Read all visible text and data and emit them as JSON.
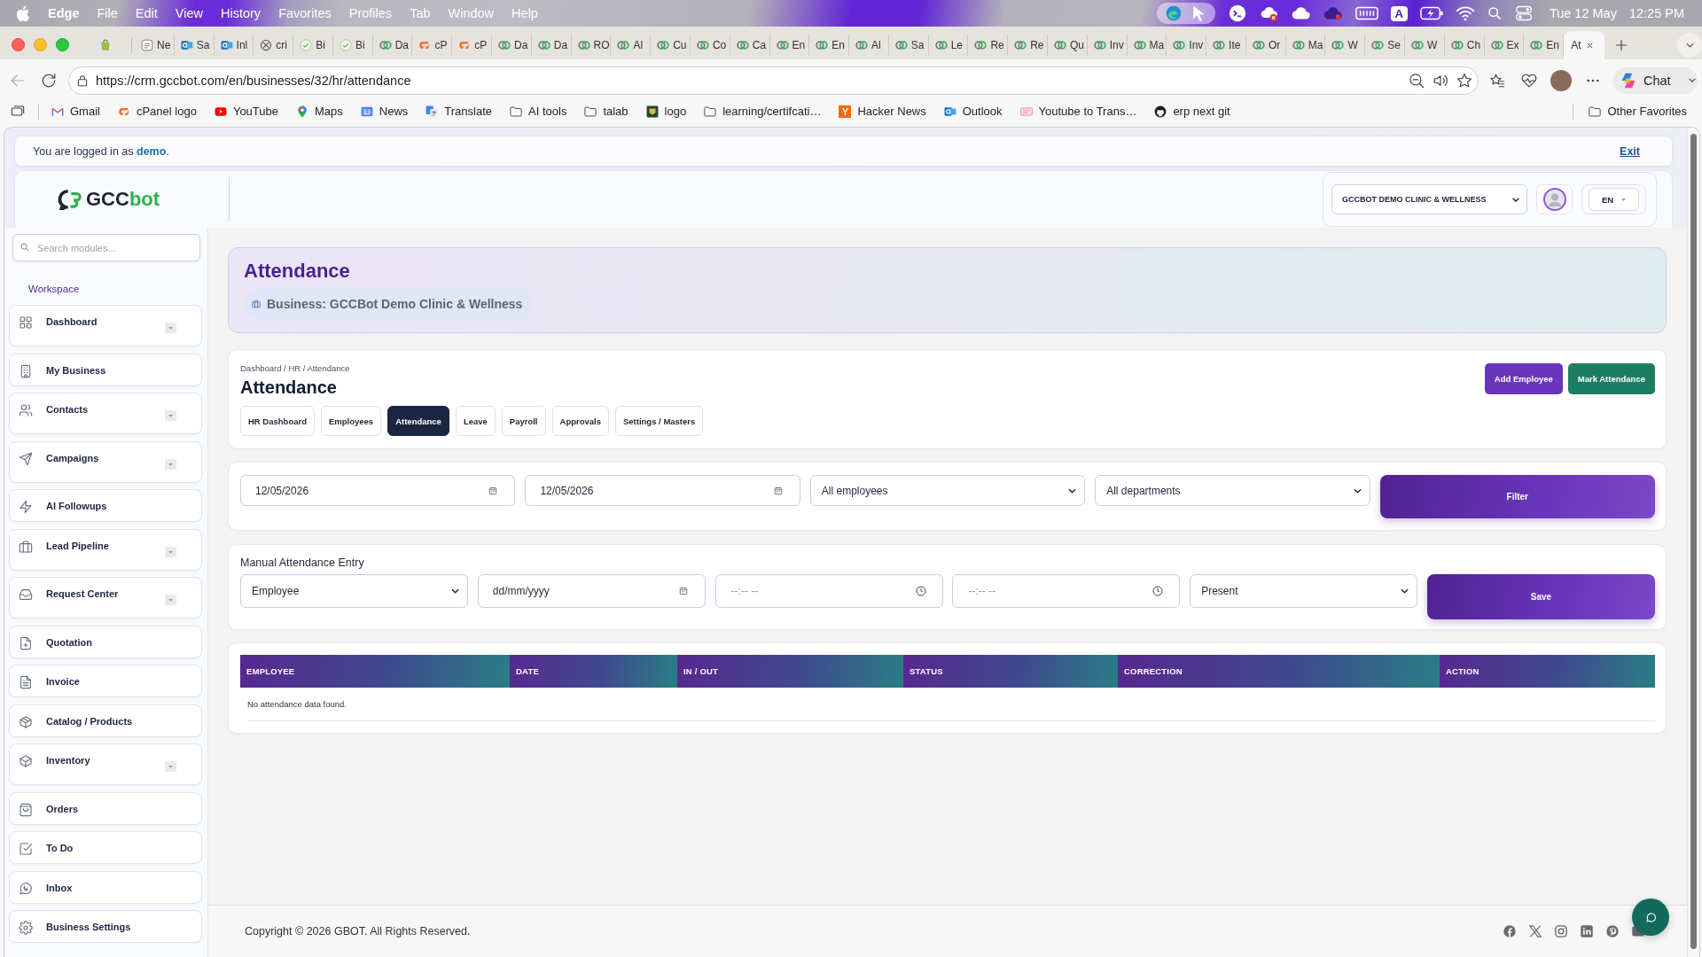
{
  "menu_bar": {
    "app": "Edge",
    "menus": [
      "File",
      "Edit",
      "View",
      "History",
      "Favorites",
      "Profiles",
      "Tab",
      "Window",
      "Help"
    ],
    "input_source": "A",
    "date": "Tue 12 May",
    "time": "12:25 PM"
  },
  "tabs": [
    {
      "title": "Ne",
      "kind": "calendar",
      "selected": false
    },
    {
      "title": "Sa",
      "kind": "mail",
      "selected": false
    },
    {
      "title": "Inl",
      "kind": "mail",
      "selected": false
    },
    {
      "title": "cri",
      "kind": "knot",
      "selected": false
    },
    {
      "title": "Bi",
      "kind": "check",
      "selected": false
    },
    {
      "title": "Bi",
      "kind": "check",
      "selected": false
    },
    {
      "title": "Da",
      "kind": "rings",
      "selected": false
    },
    {
      "title": "cP",
      "kind": "swirl",
      "selected": false
    },
    {
      "title": "cP",
      "kind": "swirl",
      "selected": false
    },
    {
      "title": "Da",
      "kind": "rings",
      "selected": false
    },
    {
      "title": "Da",
      "kind": "rings",
      "selected": false
    },
    {
      "title": "RO",
      "kind": "rings",
      "selected": false
    },
    {
      "title": "Al",
      "kind": "rings",
      "selected": false
    },
    {
      "title": "Cu",
      "kind": "rings",
      "selected": false
    },
    {
      "title": "Co",
      "kind": "rings",
      "selected": false
    },
    {
      "title": "Ca",
      "kind": "rings",
      "selected": false
    },
    {
      "title": "En",
      "kind": "rings",
      "selected": false
    },
    {
      "title": "En",
      "kind": "rings",
      "selected": false
    },
    {
      "title": "Al",
      "kind": "rings",
      "selected": false
    },
    {
      "title": "Sa",
      "kind": "rings",
      "selected": false
    },
    {
      "title": "Le",
      "kind": "rings",
      "selected": false
    },
    {
      "title": "Re",
      "kind": "rings",
      "selected": false
    },
    {
      "title": "Re",
      "kind": "rings",
      "selected": false
    },
    {
      "title": "Qu",
      "kind": "rings",
      "selected": false
    },
    {
      "title": "Inv",
      "kind": "rings",
      "selected": false
    },
    {
      "title": "Ma",
      "kind": "rings",
      "selected": false
    },
    {
      "title": "Inv",
      "kind": "rings",
      "selected": false
    },
    {
      "title": "Ite",
      "kind": "rings",
      "selected": false
    },
    {
      "title": "Or",
      "kind": "rings",
      "selected": false
    },
    {
      "title": "Ma",
      "kind": "rings",
      "selected": false
    },
    {
      "title": "W",
      "kind": "rings",
      "selected": false
    },
    {
      "title": "Se",
      "kind": "rings",
      "selected": false
    },
    {
      "title": "W",
      "kind": "rings",
      "selected": false
    },
    {
      "title": "Ch",
      "kind": "rings",
      "selected": false
    },
    {
      "title": "Ex",
      "kind": "rings",
      "selected": false
    },
    {
      "title": "En",
      "kind": "rings",
      "selected": false
    },
    {
      "title": "At",
      "selected": true
    }
  ],
  "toolbar": {
    "url": "https://crm.gccbot.com/en/businesses/32/hr/attendance",
    "chat": "Chat"
  },
  "bookmarks": [
    {
      "label": "Gmail",
      "kind": "envelope"
    },
    {
      "label": "cPanel logo",
      "kind": "swirl"
    },
    {
      "label": "YouTube",
      "kind": "play"
    },
    {
      "label": "Maps",
      "kind": "pin"
    },
    {
      "label": "News",
      "kind": "news"
    },
    {
      "label": "Translate",
      "kind": "translate"
    },
    {
      "label": "AI tools",
      "kind": "folder"
    },
    {
      "label": "talab",
      "kind": "folder"
    },
    {
      "label": "logo",
      "kind": "emblem"
    },
    {
      "label": "learning/certifcati…",
      "kind": "folder"
    },
    {
      "label": "Hacker News",
      "kind": "letter",
      "glyph": "Y"
    },
    {
      "label": "Outlook",
      "kind": "mail"
    },
    {
      "label": "Youtube to Trans…",
      "kind": "video"
    },
    {
      "label": "erp next git",
      "kind": "cat"
    }
  ],
  "other_favorites": "Other Favorites",
  "notice": {
    "prefix": "You are logged in as",
    "user": "demo",
    "suffix": ".",
    "exit": "Exit"
  },
  "header": {
    "logo_dark": "GCC",
    "logo_accent": "bot",
    "business": "GCCBOT DEMO CLINIC & WELLNESS",
    "language": "EN"
  },
  "sidebar": {
    "search": {
      "placeholder": "Search modules..."
    },
    "section": "Workspace",
    "items": [
      {
        "label": "Dashboard",
        "kind": "grid",
        "expandable": true,
        "selected": false
      },
      {
        "label": "My Business",
        "kind": "building",
        "expandable": false,
        "selected": false
      },
      {
        "label": "Contacts",
        "kind": "users",
        "expandable": true,
        "selected": false
      },
      {
        "label": "Campaigns",
        "kind": "send",
        "expandable": true,
        "selected": false
      },
      {
        "label": "AI Followups",
        "kind": "bolt",
        "expandable": false,
        "selected": false
      },
      {
        "label": "Lead Pipeline",
        "kind": "briefcase",
        "expandable": true,
        "selected": false
      },
      {
        "label": "Request Center",
        "kind": "tray",
        "expandable": true,
        "selected": false
      },
      {
        "label": "Quotation",
        "kind": "filePlus",
        "expandable": false,
        "selected": false
      },
      {
        "label": "Invoice",
        "kind": "fileText",
        "expandable": false,
        "selected": false
      },
      {
        "label": "Catalog / Products",
        "kind": "package",
        "expandable": false,
        "selected": false
      },
      {
        "label": "Inventory",
        "kind": "box",
        "expandable": true,
        "selected": false
      },
      {
        "label": "Orders",
        "kind": "bag",
        "expandable": false,
        "selected": false
      },
      {
        "label": "To Do",
        "kind": "todo",
        "expandable": false,
        "selected": false
      },
      {
        "label": "Inbox",
        "kind": "chat",
        "expandable": false,
        "selected": false
      },
      {
        "label": "Business Settings",
        "kind": "gear",
        "expandable": false,
        "selected": false
      }
    ]
  },
  "hero": {
    "title": "Attendance",
    "business": "Business: GCCBot Demo Clinic & Wellness"
  },
  "hr": {
    "breadcrumb": "Dashboard / HR / Attendance",
    "title": "Attendance",
    "tabs": [
      {
        "label": "HR Dashboard",
        "selected": false
      },
      {
        "label": "Employees",
        "selected": false
      },
      {
        "label": "Attendance",
        "selected": true
      },
      {
        "label": "Leave",
        "selected": false
      },
      {
        "label": "Payroll",
        "selected": false
      },
      {
        "label": "Approvals",
        "selected": false
      },
      {
        "label": "Settings / Masters",
        "selected": false
      }
    ],
    "actions": [
      {
        "label": "Add Employee",
        "kind": "primary"
      },
      {
        "label": "Mark Attendance",
        "kind": "success"
      }
    ]
  },
  "filters": {
    "fields": [
      {
        "kind": "date",
        "value": "12/05/2026"
      },
      {
        "kind": "date",
        "value": "12/05/2026"
      },
      {
        "kind": "select",
        "value": "All employees"
      },
      {
        "kind": "select",
        "value": "All departments"
      }
    ],
    "button": "Filter"
  },
  "manual_entry": {
    "title": "Manual Attendance Entry",
    "fields": [
      {
        "kind": "select",
        "value": "Employee"
      },
      {
        "kind": "date",
        "placeholder": "dd/mm/yyyy"
      },
      {
        "kind": "time",
        "placeholder": "--:-- --"
      },
      {
        "kind": "time",
        "placeholder": "--:-- --"
      },
      {
        "kind": "select",
        "value": "Present"
      }
    ],
    "button": "Save"
  },
  "table": {
    "columns": [
      "EMPLOYEE",
      "DATE",
      "IN / OUT",
      "STATUS",
      "CORRECTION",
      "ACTION"
    ],
    "empty_message": "No attendance data found."
  },
  "footer": {
    "copyright": "Copyright © 2026 GBOT. All Rights Reserved."
  }
}
